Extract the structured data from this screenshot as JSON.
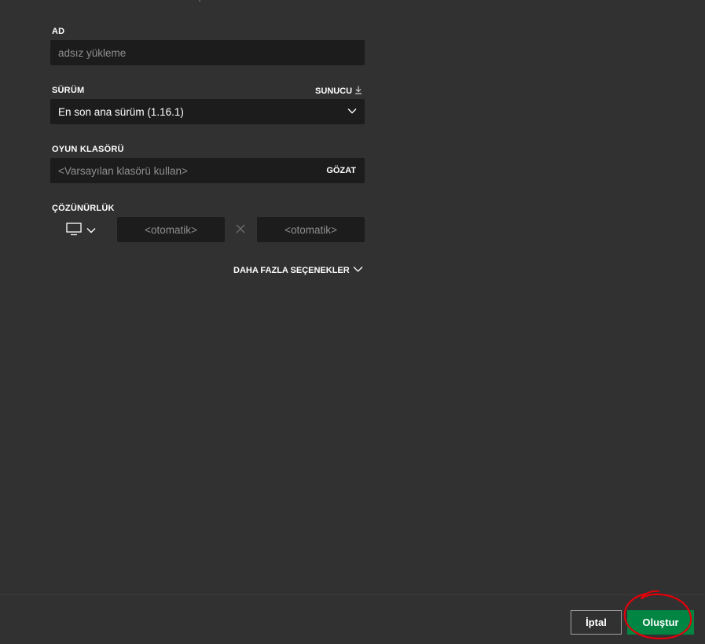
{
  "form": {
    "name_label": "AD",
    "name_placeholder": "adsız yükleme",
    "version_label": "SÜRÜM",
    "server_link_label": "SUNUCU",
    "version_value": "En son ana sürüm (1.16.1)",
    "game_folder_label": "OYUN KLASÖRÜ",
    "game_folder_placeholder": "<Varsayılan klasörü kullan>",
    "browse_label": "GÖZAT",
    "resolution_label": "ÇÖZÜNÜRLÜK",
    "resolution_width_placeholder": "<otomatik>",
    "resolution_height_placeholder": "<otomatik>",
    "more_options_label": "DAHA FAZLA SEÇENEKLER"
  },
  "footer": {
    "cancel_label": "İptal",
    "create_label": "Oluştur"
  },
  "colors": {
    "background": "#313131",
    "field_background": "#1c1c1c",
    "create_button": "#008542",
    "annotation_circle": "#e3000b"
  },
  "icons": {
    "server_link": "download-arrow-icon",
    "version_dropdown": "chevron-down-icon",
    "display": "monitor-icon",
    "display_dropdown": "chevron-down-icon",
    "resolution_separator": "close-x-icon",
    "more_options": "chevron-down-icon"
  }
}
